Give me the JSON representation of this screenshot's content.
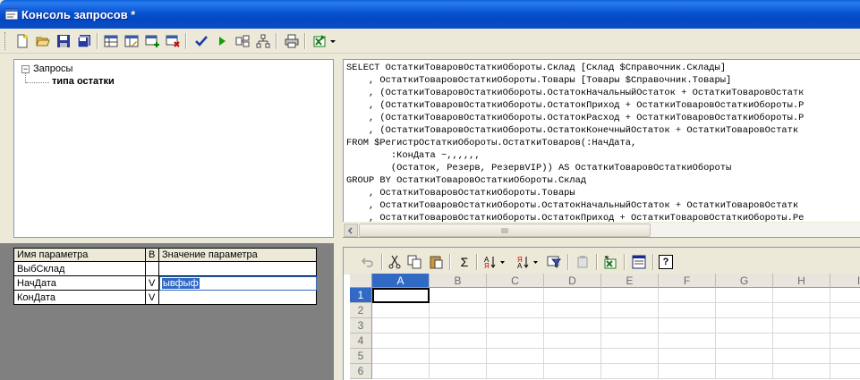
{
  "window": {
    "title": "Консоль запросов *"
  },
  "toolbar": {
    "buttons": [
      {
        "icon": "new-document-icon"
      },
      {
        "icon": "open-folder-icon"
      },
      {
        "icon": "save-icon"
      },
      {
        "icon": "save-all-icon"
      },
      {
        "icon": "table-icon"
      },
      {
        "icon": "table-edit-icon"
      },
      {
        "icon": "table-add-icon"
      },
      {
        "icon": "table-delete-icon"
      },
      {
        "icon": "check-icon"
      },
      {
        "icon": "run-icon"
      },
      {
        "icon": "query-wizard-icon"
      },
      {
        "icon": "tree-icon"
      },
      {
        "icon": "print-icon"
      },
      {
        "icon": "export-excel-icon"
      }
    ]
  },
  "tree": {
    "root_label": "Запросы",
    "child_label": "типа остатки"
  },
  "query": {
    "lines": [
      "SELECT ОстаткиТоваровОстаткиОбороты.Склад [Склад $Справочник.Склады]",
      "    , ОстаткиТоваровОстаткиОбороты.Товары [Товары $Справочник.Товары]",
      "    , (ОстаткиТоваровОстаткиОбороты.ОстатокНачальныйОстаток + ОстаткиТоваровОстатк",
      "    , (ОстаткиТоваровОстаткиОбороты.ОстатокПриход + ОстаткиТоваровОстаткиОбороты.Р",
      "    , (ОстаткиТоваровОстаткиОбороты.ОстатокРасход + ОстаткиТоваровОстаткиОбороты.Р",
      "    , (ОстаткиТоваровОстаткиОбороты.ОстатокКонечныйОстаток + ОстаткиТоваровОстатк",
      "FROM $РегистрОстаткиОбороты.ОстаткиТоваров(:НачДата,",
      "        :КонДата ~,,,,,,",
      "        (Остаток, Резерв, РезервVIP)) AS ОстаткиТоваровОстаткиОбороты",
      "GROUP BY ОстаткиТоваровОстаткиОбороты.Склад",
      "    , ОстаткиТоваровОстаткиОбороты.Товары",
      "    , ОстаткиТоваровОстаткиОбороты.ОстатокНачальныйОстаток + ОстаткиТоваровОстатк",
      "    , ОстаткиТоваровОстаткиОбороты.ОстатокПриход + ОстаткиТоваровОстаткиОбороты.Ре"
    ]
  },
  "params": {
    "headers": [
      "Имя параметра",
      "В",
      "Значение параметра"
    ],
    "rows": [
      {
        "name": "ВыбСклад",
        "b": "",
        "value": ""
      },
      {
        "name": "НачДата",
        "b": "V",
        "value": "ывфыф"
      },
      {
        "name": "КонДата",
        "b": "V",
        "value": ""
      }
    ]
  },
  "sheet": {
    "columns": [
      "A",
      "B",
      "C",
      "D",
      "E",
      "F",
      "G",
      "H",
      "I"
    ],
    "rows": [
      "1",
      "2",
      "3",
      "4",
      "5",
      "6"
    ],
    "toolbar_icons": [
      "undo-icon",
      "cut-icon",
      "copy-icon",
      "paste-icon",
      "sum-icon",
      "sort-asc-icon",
      "sort-desc-icon",
      "filter-icon",
      "format-icon",
      "export-icon",
      "properties-icon",
      "help-icon"
    ],
    "sum_glyph": "Σ",
    "help_glyph": "?"
  }
}
